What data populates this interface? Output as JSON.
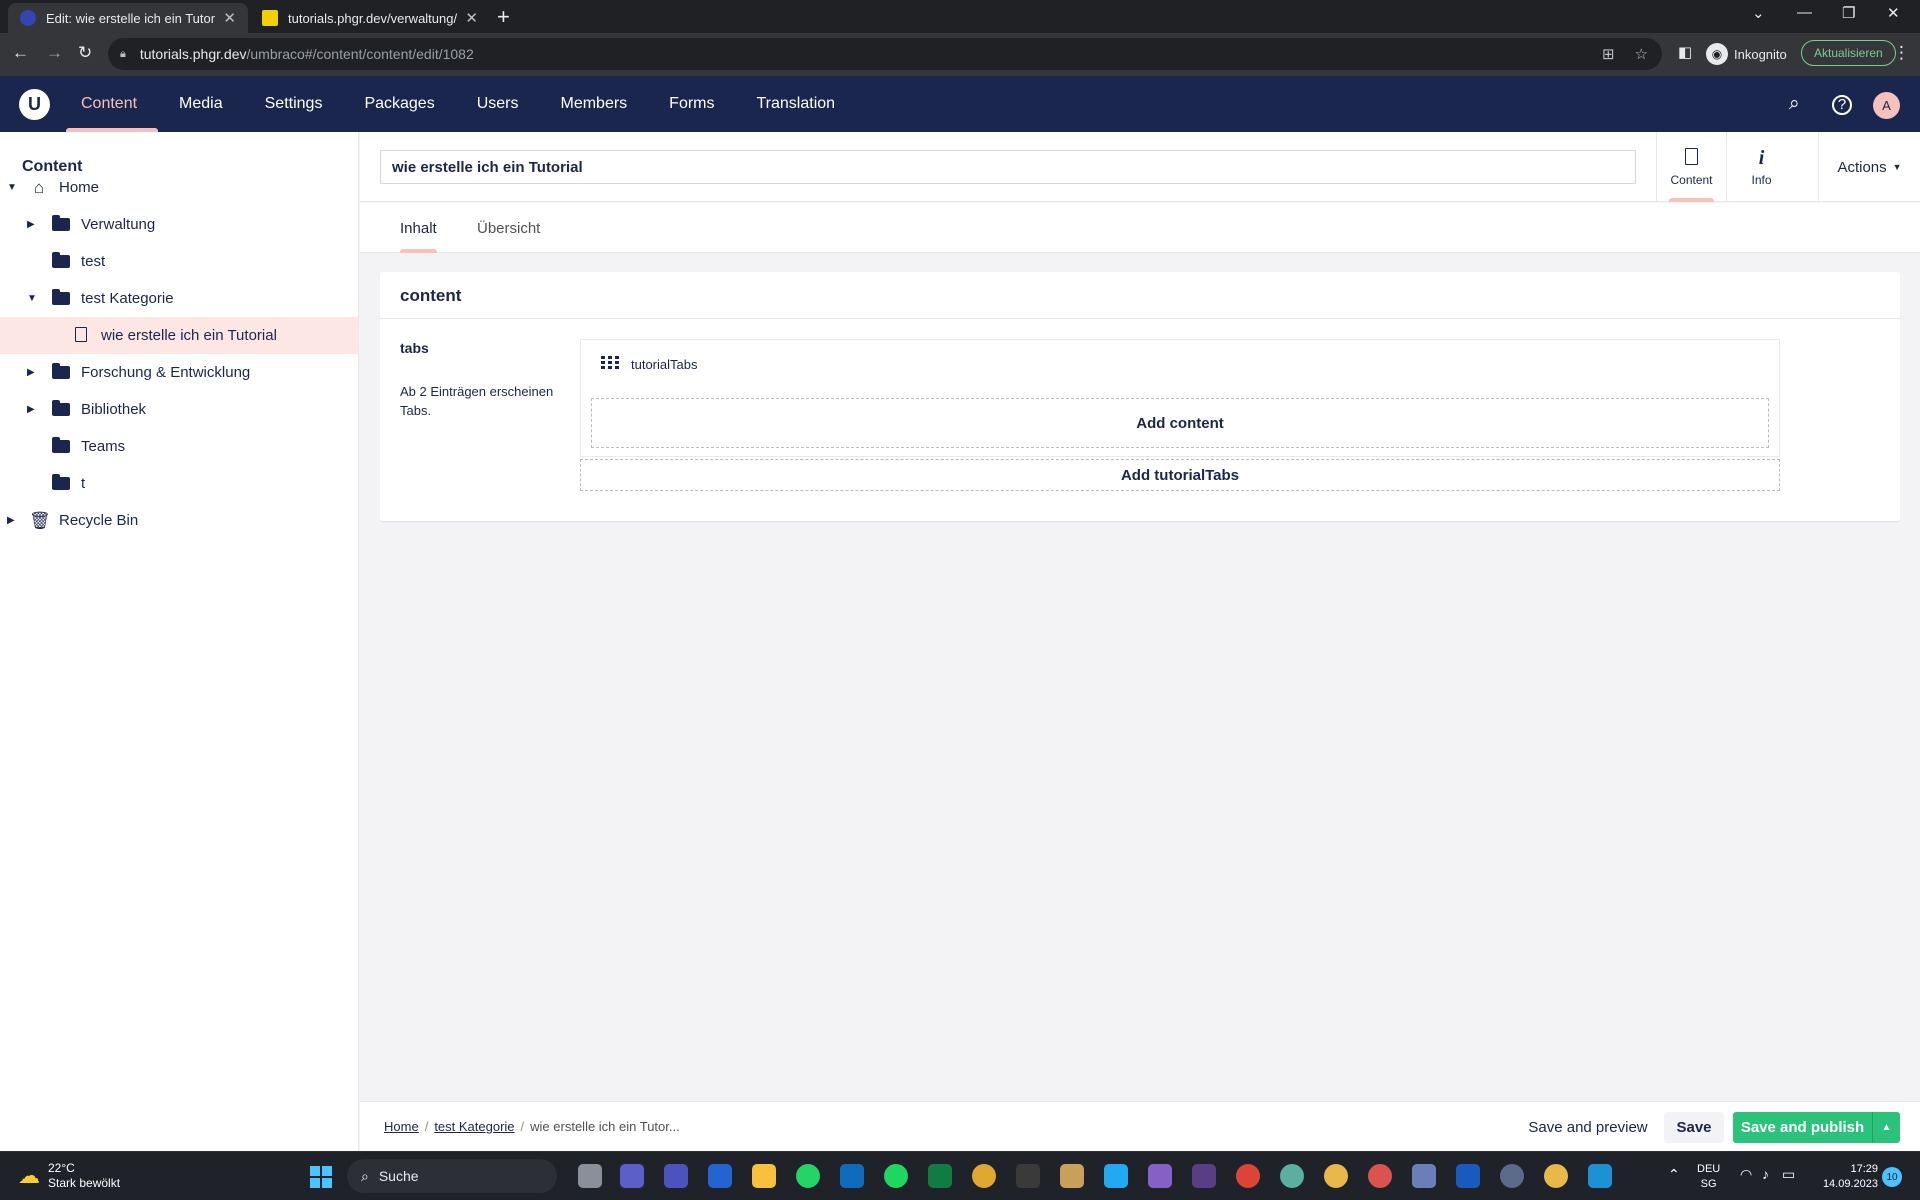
{
  "browser": {
    "tabs": [
      {
        "title": "Edit: wie erstelle ich ein Tutorial -",
        "active": true,
        "favicon_color": "#3544b1"
      },
      {
        "title": "tutorials.phgr.dev/verwaltung/inf",
        "active": false,
        "favicon_color": "#f0d000"
      }
    ],
    "url_host": "tutorials.phgr.dev",
    "url_path": "/umbraco#/content/content/edit/1082",
    "incognito_label": "Inkognito",
    "update_label": "Aktualisieren"
  },
  "umbraco": {
    "logo": "U",
    "sections": [
      "Content",
      "Media",
      "Settings",
      "Packages",
      "Users",
      "Members",
      "Forms",
      "Translation"
    ],
    "active_section": "Content",
    "avatar_initial": "A"
  },
  "tree": {
    "title": "Content",
    "nodes": [
      {
        "label": "Home",
        "icon": "home-icon",
        "level": 0,
        "caret": "expanded"
      },
      {
        "label": "Verwaltung",
        "icon": "folder-icon",
        "level": 1,
        "caret": "collapsed"
      },
      {
        "label": "test",
        "icon": "folder-icon",
        "level": 1,
        "caret": "none"
      },
      {
        "label": "test Kategorie",
        "icon": "folder-icon",
        "level": 1,
        "caret": "expanded"
      },
      {
        "label": "wie erstelle ich ein Tutorial",
        "icon": "document-icon",
        "level": 2,
        "caret": "none",
        "selected": true
      },
      {
        "label": "Forschung & Entwicklung",
        "icon": "folder-icon",
        "level": 1,
        "caret": "collapsed"
      },
      {
        "label": "Bibliothek",
        "icon": "folder-icon",
        "level": 1,
        "caret": "collapsed"
      },
      {
        "label": "Teams",
        "icon": "folder-icon",
        "level": 1,
        "caret": "none"
      },
      {
        "label": "t",
        "icon": "folder-icon",
        "level": 1,
        "caret": "none"
      },
      {
        "label": "Recycle Bin",
        "icon": "trash-icon",
        "level": 0,
        "caret": "collapsed"
      }
    ]
  },
  "editor": {
    "name_value": "wie erstelle ich ein Tutorial",
    "apps": [
      {
        "label": "Content",
        "icon": "document-icon"
      },
      {
        "label": "Info",
        "icon": "info-icon"
      }
    ],
    "actions_label": "Actions",
    "tabs": [
      "Inhalt",
      "Übersicht"
    ],
    "active_tab": "Inhalt",
    "group_title": "content",
    "property": {
      "label": "tabs",
      "description": "Ab 2 Einträgen erscheinen Tabs."
    },
    "block": {
      "name": "tutorialTabs",
      "add_content_label": "Add content",
      "add_block_label": "Add tutorialTabs"
    }
  },
  "footer": {
    "breadcrumb": [
      "Home",
      "test Kategorie",
      "wie erstelle ich ein Tutor..."
    ],
    "save_preview_label": "Save and preview",
    "save_label": "Save",
    "publish_label": "Save and publish"
  },
  "taskbar": {
    "weather_temp": "22°C",
    "weather_desc": "Stark bewölkt",
    "search_label": "Suche",
    "lang_primary": "DEU",
    "lang_secondary": "SG",
    "time": "17:29",
    "date": "14.09.2023",
    "notification_count": "10"
  },
  "colors": {
    "header_bg": "#1b264f",
    "accent": "#f5c1bc",
    "publish_green": "#2bc37c"
  }
}
